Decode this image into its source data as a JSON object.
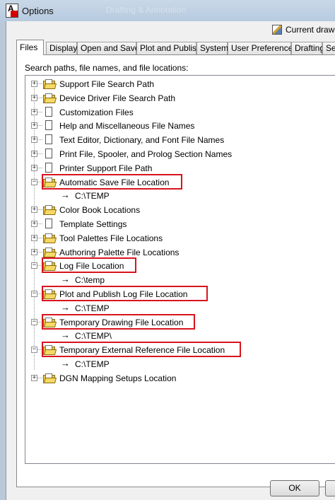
{
  "window": {
    "title": "Options",
    "ghost_title": "Drafting & Annotation",
    "current_drawing_label": "Current drawing"
  },
  "tabs": [
    "Files",
    "Display",
    "Open and Save",
    "Plot and Publish",
    "System",
    "User Preferences",
    "Drafting",
    "Se"
  ],
  "panel": {
    "label": "Search paths, file names, and file locations:"
  },
  "tree": [
    {
      "label": "Support File Search Path",
      "icon": "folder-icon",
      "state": "collapsed"
    },
    {
      "label": "Device Driver File Search Path",
      "icon": "folder-icon",
      "state": "collapsed"
    },
    {
      "label": "Customization Files",
      "icon": "document-icon",
      "state": "collapsed"
    },
    {
      "label": "Help and Miscellaneous File Names",
      "icon": "document-icon",
      "state": "collapsed"
    },
    {
      "label": "Text Editor, Dictionary, and Font File Names",
      "icon": "document-icon",
      "state": "collapsed"
    },
    {
      "label": "Print File, Spooler, and Prolog Section Names",
      "icon": "document-icon",
      "state": "collapsed"
    },
    {
      "label": "Printer Support File Path",
      "icon": "document-icon",
      "state": "collapsed"
    },
    {
      "label": "Automatic Save File Location",
      "icon": "folder-icon",
      "state": "expanded",
      "highlighted": true,
      "child": "C:\\TEMP"
    },
    {
      "label": "Color Book Locations",
      "icon": "folder-icon",
      "state": "collapsed"
    },
    {
      "label": "Template Settings",
      "icon": "document-icon",
      "state": "collapsed"
    },
    {
      "label": "Tool Palettes File Locations",
      "icon": "folder-icon",
      "state": "collapsed"
    },
    {
      "label": "Authoring Palette File Locations",
      "icon": "folder-icon",
      "state": "collapsed"
    },
    {
      "label": "Log File Location",
      "icon": "folder-icon",
      "state": "expanded",
      "highlighted": true,
      "child": "C:\\temp"
    },
    {
      "label": "Plot and Publish Log File Location",
      "icon": "folder-icon",
      "state": "expanded",
      "highlighted": true,
      "child": "C:\\TEMP"
    },
    {
      "label": "Temporary Drawing File Location",
      "icon": "folder-icon",
      "state": "expanded",
      "highlighted": true,
      "child": "C:\\TEMP\\"
    },
    {
      "label": "Temporary External Reference File Location",
      "icon": "folder-icon",
      "state": "expanded",
      "highlighted": true,
      "child": "C:\\TEMP"
    },
    {
      "label": "DGN Mapping Setups Location",
      "icon": "folder-icon",
      "state": "collapsed"
    }
  ],
  "buttons": {
    "ok": "OK"
  },
  "colors": {
    "highlight_border": "#d8141d",
    "folder": "#e6c24a"
  }
}
